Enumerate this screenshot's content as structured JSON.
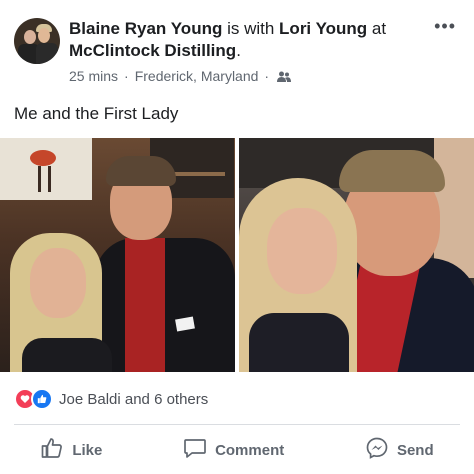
{
  "post": {
    "author": "Blaine Ryan Young",
    "with_text": "is with",
    "tagged": "Lori Young",
    "at_text": "at",
    "place": "McClintock Distilling",
    "place_suffix": ".",
    "time": "25 mins",
    "separator": "·",
    "location": "Frederick, Maryland",
    "caption": "Me and the First Lady",
    "more_label": "•••"
  },
  "reactions": {
    "text": "Joe Baldi and 6 others",
    "icons": [
      "love-icon",
      "like-icon"
    ]
  },
  "actions": [
    {
      "label": "Like",
      "icon": "thumbs-up-icon"
    },
    {
      "label": "Comment",
      "icon": "comment-bubble-icon"
    },
    {
      "label": "Send",
      "icon": "messenger-icon"
    }
  ],
  "colors": {
    "accent": "#1877f2",
    "love": "#f33e58",
    "text": "#1c1e21",
    "muted": "#606770"
  }
}
